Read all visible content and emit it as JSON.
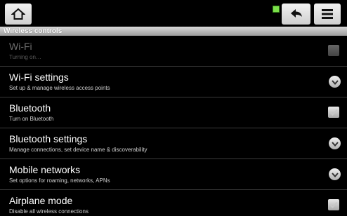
{
  "top_bar": {
    "icons": [
      "home-icon",
      "back-arrow-icon",
      "menu-icon"
    ],
    "status_color": "#7be04a"
  },
  "section_header": "Wireless controls",
  "items": [
    {
      "title": "Wi-Fi",
      "summary": "Turning on…",
      "control": "checkbox",
      "checked": false,
      "enabled": false
    },
    {
      "title": "Wi-Fi settings",
      "summary": "Set up & manage wireless access points",
      "control": "chevron"
    },
    {
      "title": "Bluetooth",
      "summary": "Turn on Bluetooth",
      "control": "checkbox",
      "checked": false,
      "enabled": true
    },
    {
      "title": "Bluetooth settings",
      "summary": "Manage connections, set device name & discoverability",
      "control": "chevron"
    },
    {
      "title": "Mobile networks",
      "summary": "Set options for roaming, networks, APNs",
      "control": "chevron"
    },
    {
      "title": "Airplane mode",
      "summary": "Disable all wireless connections",
      "control": "checkbox",
      "checked": false,
      "enabled": true
    }
  ]
}
